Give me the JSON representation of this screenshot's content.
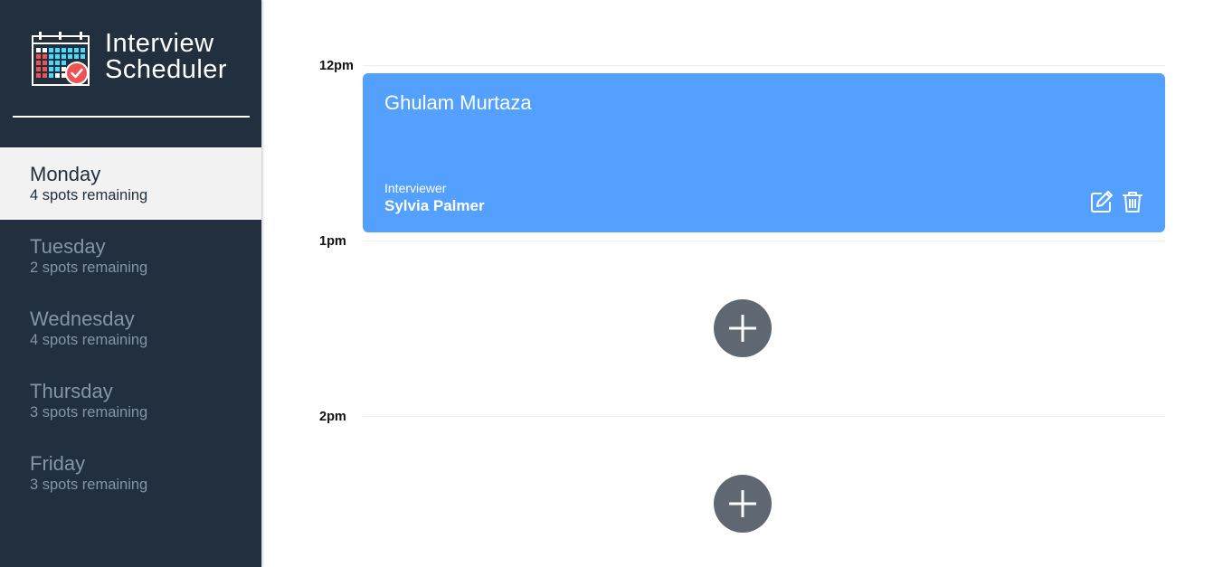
{
  "brand": {
    "line1": "Interview",
    "line2": "Scheduler",
    "logo_icon": "calendar-check-icon"
  },
  "days": [
    {
      "name": "Monday",
      "spots": "4 spots remaining",
      "selected": true
    },
    {
      "name": "Tuesday",
      "spots": "2 spots remaining",
      "selected": false
    },
    {
      "name": "Wednesday",
      "spots": "4 spots remaining",
      "selected": false
    },
    {
      "name": "Thursday",
      "spots": "3 spots remaining",
      "selected": false
    },
    {
      "name": "Friday",
      "spots": "3 spots remaining",
      "selected": false
    }
  ],
  "schedule": {
    "times": [
      "12pm",
      "1pm",
      "2pm"
    ],
    "appointment": {
      "student": "Ghulam Murtaza",
      "interviewer_label": "Interviewer",
      "interviewer": "Sylvia Palmer",
      "edit_icon": "edit-icon",
      "delete_icon": "trash-icon"
    },
    "add_icon": "plus-icon"
  },
  "colors": {
    "sidebar": "#222f3e",
    "selected_day_bg": "#f2f2f2",
    "unselected_text": "#8395a7",
    "appointment": "#54a0ff",
    "add_button": "#5f6772"
  }
}
